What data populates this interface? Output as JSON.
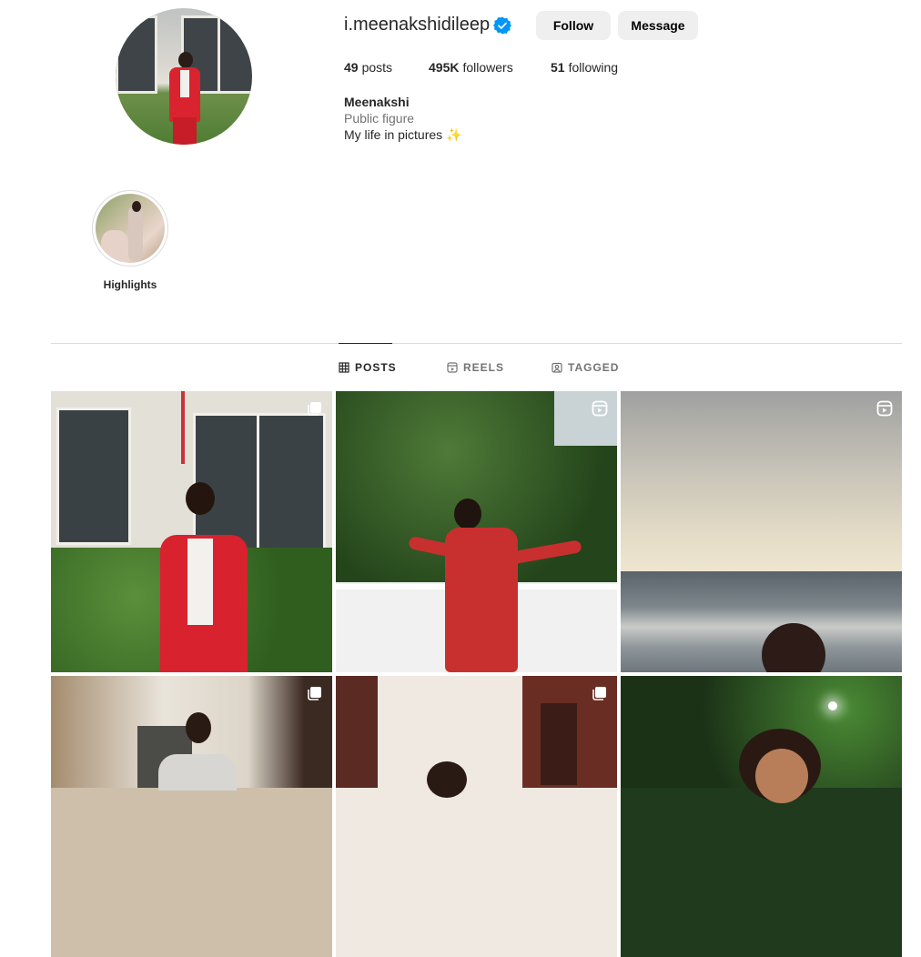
{
  "profile": {
    "username": "i.meenakshidileep",
    "verified": true,
    "follow_label": "Follow",
    "message_label": "Message",
    "stats": {
      "posts_count": "49",
      "posts_label": "posts",
      "followers_count": "495K",
      "followers_label": "followers",
      "following_count": "51",
      "following_label": "following"
    },
    "display_name": "Meenakshi",
    "category": "Public figure",
    "bio": "My life in pictures ✨"
  },
  "highlights": [
    {
      "label": "Highlights"
    }
  ],
  "tabs": [
    {
      "label": "POSTS",
      "icon": "grid-icon",
      "active": true
    },
    {
      "label": "REELS",
      "icon": "reels-icon",
      "active": false
    },
    {
      "label": "TAGGED",
      "icon": "tagged-icon",
      "active": false
    }
  ],
  "posts": [
    {
      "subject": "woman in red suit by window",
      "badge": "carousel-icon"
    },
    {
      "subject": "woman dancing in red kurta",
      "badge": "reel-icon"
    },
    {
      "subject": "beach at sunset",
      "badge": "reel-icon"
    },
    {
      "subject": "woman in hallway",
      "badge": "carousel-icon"
    },
    {
      "subject": "woman by door",
      "badge": "carousel-icon"
    },
    {
      "subject": "woman in garden at night",
      "badge": "none"
    }
  ],
  "colors": {
    "verified_blue": "#0095f6",
    "button_bg": "#efefef",
    "divider": "#dbdbdb",
    "muted_text": "#737373"
  }
}
